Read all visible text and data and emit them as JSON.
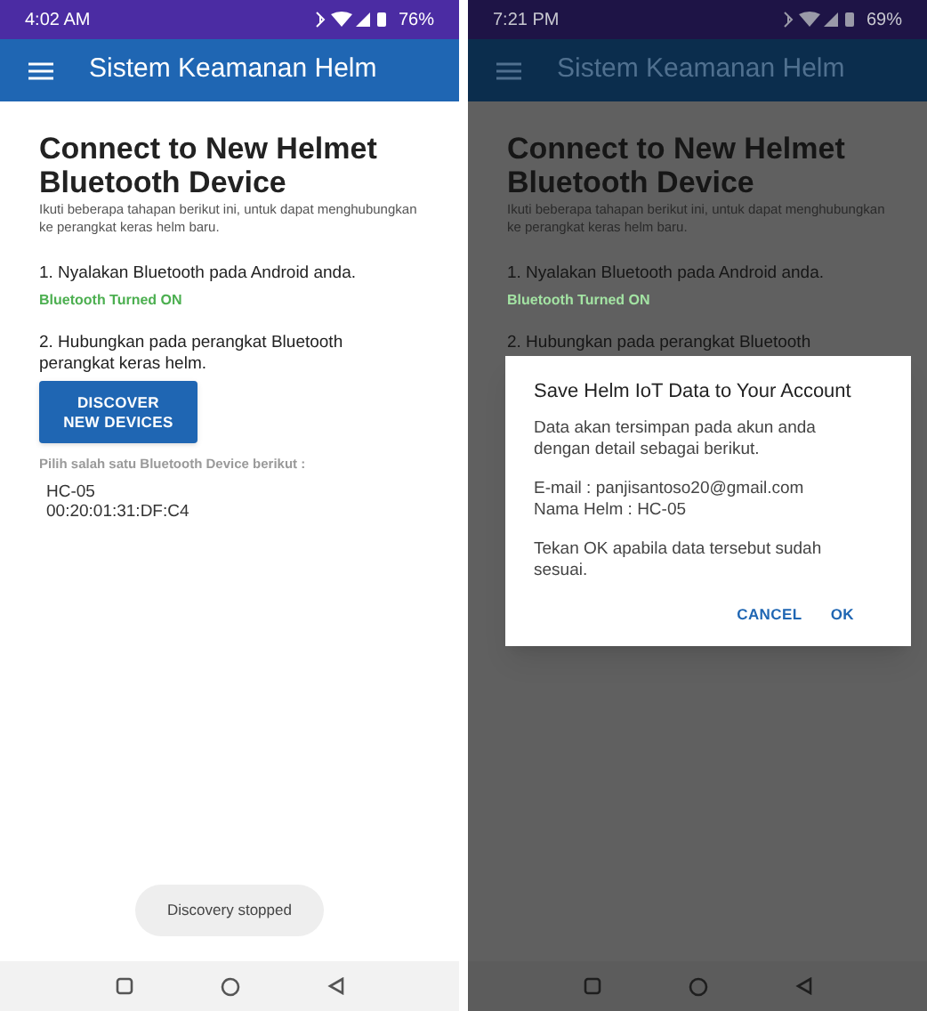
{
  "screens": [
    {
      "dimmed": false,
      "status_bar": {
        "time": "4:02 AM",
        "battery": "76%"
      },
      "app_bar": {
        "title": "Sistem Keamanan Helm"
      },
      "content": {
        "heading": "Connect to New Helmet Bluetooth Device",
        "intro": "Ikuti beberapa tahapan berikut ini, untuk dapat menghubungkan ke perangkat keras helm baru.",
        "step_1": "1. Nyalakan Bluetooth pada Android anda.",
        "bluetooth_status": "Bluetooth Turned ON",
        "step_2": "2. Hubungkan pada perangkat Bluetooth perangkat keras helm.",
        "discover_button": "DISCOVER NEW DEVICES",
        "device_prompt": "Pilih salah satu Bluetooth Device berikut :",
        "devices": [
          {
            "name": "HC-05",
            "address": "00:20:01:31:DF:C4"
          }
        ]
      },
      "toast": "Discovery stopped"
    },
    {
      "dimmed": true,
      "status_bar": {
        "time": "7:21 PM",
        "battery": "69%"
      },
      "app_bar": {
        "title": "Sistem Keamanan Helm"
      },
      "content": {
        "heading": "Connect to New Helmet Bluetooth Device",
        "intro": "Ikuti beberapa tahapan berikut ini, untuk dapat menghubungkan ke perangkat keras helm baru.",
        "step_1": "1. Nyalakan Bluetooth pada Android anda.",
        "bluetooth_status": "Bluetooth Turned ON",
        "step_2": "2. Hubungkan pada perangkat Bluetooth"
      },
      "dialog": {
        "title": "Save Helm IoT Data to Your Account",
        "message": "Data akan tersimpan pada akun anda dengan detail sebagai berikut.",
        "details": [
          "E-mail : panjisantoso20@gmail.com",
          "Nama Helm : HC-05"
        ],
        "note": "Tekan OK apabila data tersebut sudah sesuai.",
        "buttons": [
          "CANCEL",
          "OK"
        ]
      }
    }
  ]
}
